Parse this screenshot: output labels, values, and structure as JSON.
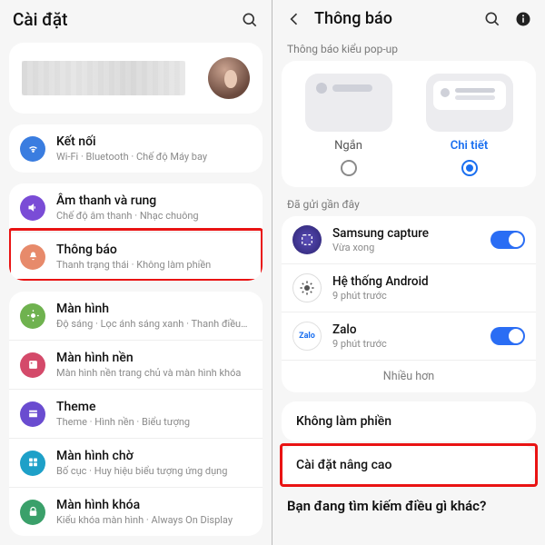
{
  "left": {
    "header_title": "Cài đặt",
    "rows": {
      "connections": {
        "title": "Kết nối",
        "sub": "Wi-Fi · Bluetooth · Chế độ Máy bay",
        "color": "#3a7de0"
      },
      "sound": {
        "title": "Âm thanh và rung",
        "sub": "Chế độ âm thanh · Nhạc chuông",
        "color": "#7a4cd6"
      },
      "notif": {
        "title": "Thông báo",
        "sub": "Thanh trạng thái · Không làm phiền",
        "color": "#e78a6b"
      },
      "display": {
        "title": "Màn hình",
        "sub": "Độ sáng · Lọc ánh sáng xanh · Thanh điều hướng",
        "color": "#6fb24f"
      },
      "wallpaper": {
        "title": "Màn hình nền",
        "sub": "Màn hình nền trang chủ và màn hình khóa",
        "color": "#d44a6a"
      },
      "themes": {
        "title": "Theme",
        "sub": "Theme · Hình nền · Biểu tượng",
        "color": "#6a4cd0"
      },
      "home": {
        "title": "Màn hình chờ",
        "sub": "Bố cục · Huy hiệu biểu tượng ứng dụng",
        "color": "#1ea0c8"
      },
      "lock": {
        "title": "Màn hình khóa",
        "sub": "Kiểu khóa màn hình · Always On Display",
        "color": "#3aa06a"
      }
    }
  },
  "right": {
    "header_title": "Thông báo",
    "popup_section": "Thông báo kiểu pop-up",
    "popup_short": "Ngắn",
    "popup_detail": "Chi tiết",
    "recent_section": "Đã gửi gần đây",
    "apps": {
      "samsung_capture": {
        "name": "Samsung capture",
        "sub": "Vừa xong"
      },
      "android_system": {
        "name": "Hệ thống Android",
        "sub": "9 phút trước"
      },
      "zalo": {
        "name": "Zalo",
        "sub": "9 phút trước"
      }
    },
    "more": "Nhiều hơn",
    "dnd": "Không làm phiền",
    "advanced": "Cài đặt nâng cao",
    "footer": "Bạn đang tìm kiếm điều gì khác?"
  }
}
